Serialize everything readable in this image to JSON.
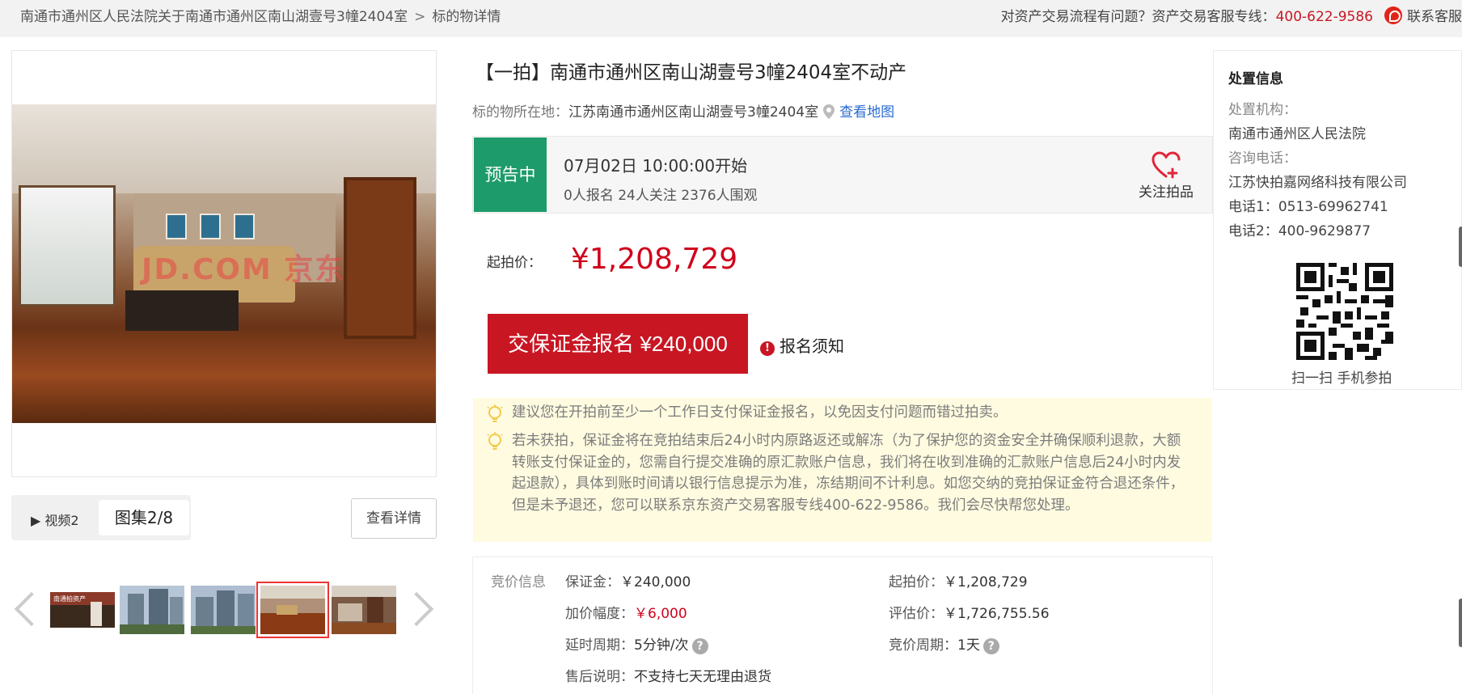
{
  "breadcrumb": {
    "parent": "南通市通州区人民法院关于南通市通州区南山湖壹号3幢2404室",
    "separator": ">",
    "current": "标的物详情"
  },
  "hotline": {
    "prompt": "对资产交易流程有问题？资产交易客服专线：",
    "number": "400-622-9586",
    "contact": "联系客服"
  },
  "gallery": {
    "watermark": "JD.COM 京东",
    "video_tab": "▶ 视频2",
    "album_tab": "图集2/8",
    "detail_button": "查看详情",
    "thumbnail_caption": "南通拍资产"
  },
  "item": {
    "title": "【一拍】南通市通州区南山湖壹号3幢2404室不动产",
    "location_label": "标的物所在地：",
    "location_value": "江苏南通市通州区南山湖壹号3幢2404室",
    "map_link": "查看地图"
  },
  "status": {
    "badge": "预告中",
    "start_time": "07月02日 10:00:00开始",
    "counts": "0人报名  24人关注  2376人围观",
    "follow_label": "关注拍品"
  },
  "price": {
    "label": "起拍价：",
    "value": "¥1,208,729"
  },
  "actions": {
    "deposit_button": "交保证金报名 ¥240,000",
    "notice_link": "报名须知"
  },
  "tips": [
    "建议您在开拍前至少一个工作日支付保证金报名，以免因支付问题而错过拍卖。",
    "若未获拍，保证金将在竞拍结束后24小时内原路返还或解冻（为了保护您的资金安全并确保顺利退款，大额转账支付保证金的，您需自行提交准确的原汇款账户信息，我们将在收到准确的汇款账户信息后24小时内发起退款），具体到账时间请以银行信息提示为准，冻结期间不计利息。如您交纳的竞拍保证金符合退还条件，但是未予退还，您可以联系京东资产交易客服专线400-622-9586。我们会尽快帮您处理。"
  ],
  "bid_info": {
    "heading": "竞价信息",
    "deposit_label": "保证金：",
    "deposit_value": "￥240,000",
    "start_label": "起拍价：",
    "start_value": "￥1,208,729",
    "increment_label": "加价幅度：",
    "increment_value": "￥6,000",
    "appraisal_label": "评估价：",
    "appraisal_value": "￥1,726,755.56",
    "delay_label": "延时周期：",
    "delay_value": "5分钟/次",
    "cycle_label": "竞价周期：",
    "cycle_value": "1天",
    "aftersale_label": "售后说明：",
    "aftersale_value": "不支持七天无理由退货"
  },
  "disposal": {
    "title": "处置信息",
    "org_label": "处置机构：",
    "org_value": "南通市通州区人民法院",
    "consult_label": "咨询电话：",
    "consult_value": "江苏快拍嘉网络科技有限公司",
    "phone1": "电话1：0513-69962741",
    "phone2": "电话2：400-9629877",
    "qr_caption": "扫一扫 手机参拍"
  },
  "colors": {
    "accent_red": "#c81623",
    "status_green": "#1e9b6a",
    "link_blue": "#2a6bd1",
    "tip_bg": "#fffbe0"
  }
}
